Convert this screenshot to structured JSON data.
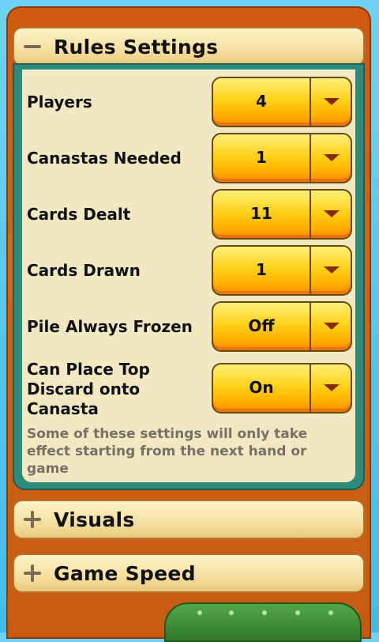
{
  "rules": {
    "title": "Rules Settings",
    "expanded_icon": "minus-icon",
    "items": [
      {
        "label": "Players",
        "value": "4"
      },
      {
        "label": "Canastas Needed",
        "value": "1"
      },
      {
        "label": "Cards Dealt",
        "value": "11"
      },
      {
        "label": "Cards Drawn",
        "value": "1"
      },
      {
        "label": "Pile Always Frozen",
        "value": "Off"
      },
      {
        "label": "Can Place Top Discard onto Canasta",
        "value": "On"
      }
    ],
    "note": "Some of these settings will only take effect starting from the next hand or game"
  },
  "visuals": {
    "title": "Visuals",
    "icon": "plus-icon"
  },
  "game_speed": {
    "title": "Game Speed",
    "icon": "plus-icon"
  },
  "colors": {
    "frame": "#cf5a12",
    "panel": "#2e8a7a",
    "dropdown": "#ffd21a",
    "arrow": "#8a2a00",
    "note_text": "#777066"
  }
}
